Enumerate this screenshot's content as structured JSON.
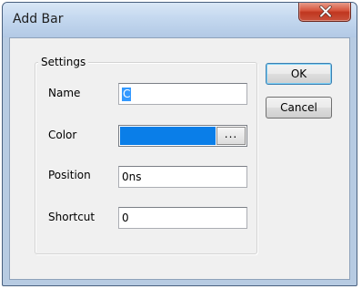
{
  "window": {
    "title": "Add Bar",
    "close_glyph": "×"
  },
  "group": {
    "title": "Settings"
  },
  "fields": {
    "name_label": "Name",
    "name_value": "C",
    "color_label": "Color",
    "color_value": "#0a7ee8",
    "color_browse_label": "...",
    "position_label": "Position",
    "position_value": "0ns",
    "shortcut_label": "Shortcut",
    "shortcut_value": "0"
  },
  "buttons": {
    "ok_label": "OK",
    "cancel_label": "Cancel"
  },
  "icons": {
    "close": "close-icon"
  }
}
